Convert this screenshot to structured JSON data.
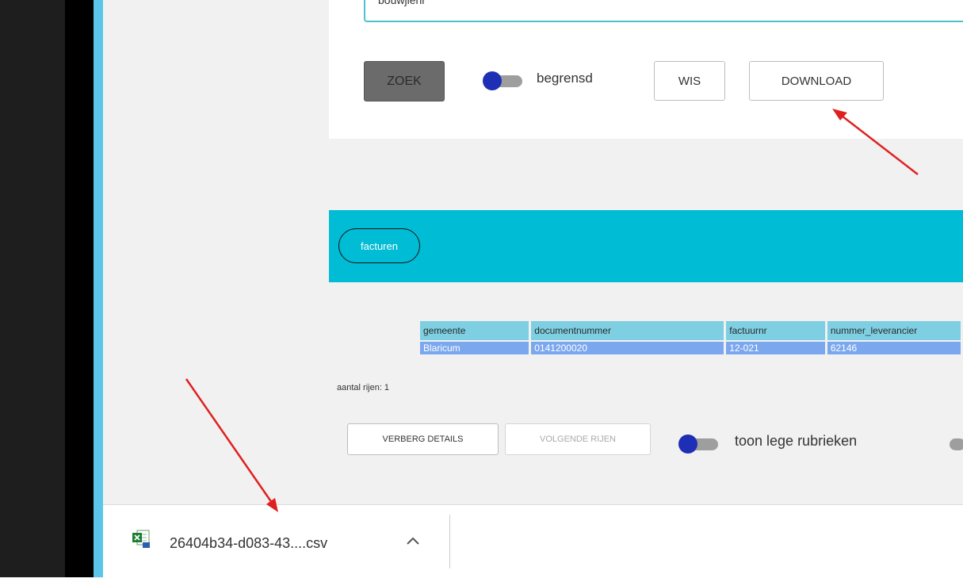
{
  "search": {
    "value": "bouwjlenr"
  },
  "toolbar": {
    "zoek_label": "ZOEK",
    "begrensd_label": "begrensd",
    "wis_label": "WIS",
    "download_label": "DOWNLOAD"
  },
  "results": {
    "chip_label": "facturen",
    "columns": [
      "gemeente",
      "documentnummer",
      "factuurnr",
      "nummer_leverancier"
    ],
    "rows": [
      [
        "Blaricum",
        "0141200020",
        "12-021",
        "62146"
      ]
    ],
    "rowcount_label": "aantal rijen: 1",
    "verberg_label": "VERBERG DETAILS",
    "volgende_label": "VOLGENDE RIJEN",
    "lege_label": "toon lege rubrieken"
  },
  "download_bar": {
    "file_name": "26404b34-d083-43....csv"
  },
  "colors": {
    "accent": "#00bcd4",
    "toggle": "#1f2fb5",
    "annotation": "#e02020"
  }
}
